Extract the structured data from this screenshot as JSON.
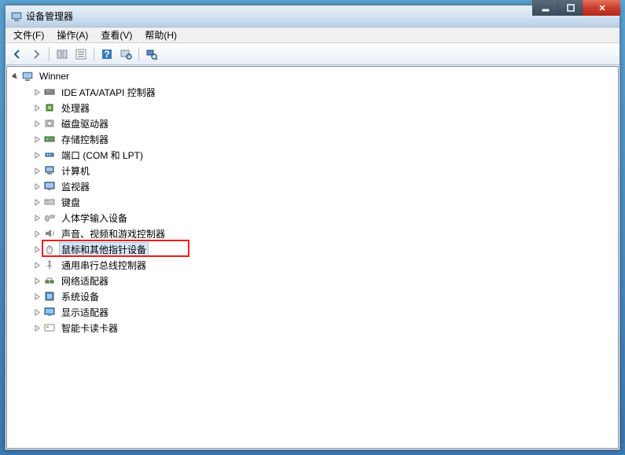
{
  "titlebar": {
    "title": "设备管理器"
  },
  "window_controls": {
    "minimize": "—",
    "maximize": "☐",
    "close": "✕"
  },
  "menubar": {
    "file": "文件(F)",
    "action": "操作(A)",
    "view": "查看(V)",
    "help": "帮助(H)"
  },
  "tree": {
    "root": "Winner",
    "items": [
      {
        "label": "IDE ATA/ATAPI 控制器",
        "icon": "ide"
      },
      {
        "label": "处理器",
        "icon": "cpu"
      },
      {
        "label": "磁盘驱动器",
        "icon": "disk"
      },
      {
        "label": "存储控制器",
        "icon": "storage"
      },
      {
        "label": "端口 (COM 和 LPT)",
        "icon": "port"
      },
      {
        "label": "计算机",
        "icon": "computer"
      },
      {
        "label": "监视器",
        "icon": "monitor"
      },
      {
        "label": "键盘",
        "icon": "keyboard"
      },
      {
        "label": "人体学输入设备",
        "icon": "hid"
      },
      {
        "label": "声音、视频和游戏控制器",
        "icon": "sound"
      },
      {
        "label": "鼠标和其他指针设备",
        "icon": "mouse",
        "selected": true,
        "highlighted": true
      },
      {
        "label": "通用串行总线控制器",
        "icon": "usb"
      },
      {
        "label": "网络适配器",
        "icon": "network"
      },
      {
        "label": "系统设备",
        "icon": "system"
      },
      {
        "label": "显示适配器",
        "icon": "display"
      },
      {
        "label": "智能卡读卡器",
        "icon": "smartcard"
      }
    ]
  }
}
